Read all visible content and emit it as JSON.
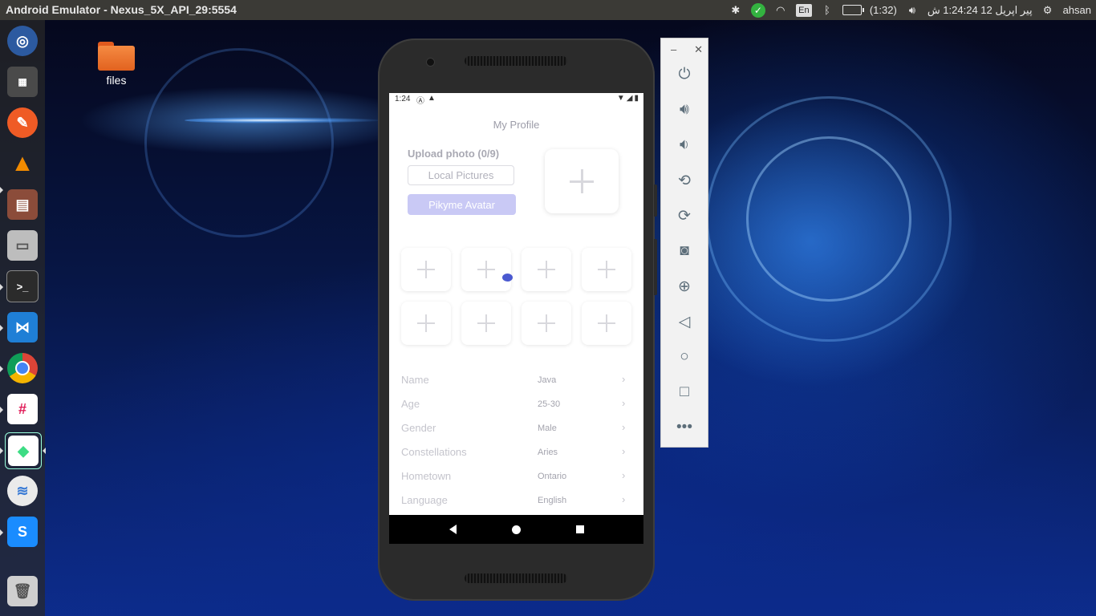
{
  "top_panel": {
    "title": "Android Emulator - Nexus_5X_API_29:5554",
    "keyboard_layout": "En",
    "battery": "(1:32)",
    "datetime": "پیر اپریل 12 1:24:24 ش",
    "user": "ahsan"
  },
  "desktop": {
    "folder_label": "files"
  },
  "launcher": {
    "items": [
      "ubuntu-dash",
      "workspaces",
      "postman",
      "vlc",
      "file-manager",
      "disk",
      "terminal",
      "vscode",
      "chrome",
      "slack",
      "android-studio",
      "database",
      "skype-preview",
      "trash"
    ]
  },
  "phone": {
    "status_time": "1:24",
    "screen_title": "My Profile",
    "upload_label": "Upload photo (0/9)",
    "local_pictures_button": "Local Pictures",
    "avatar_button": "Pikyme Avatar",
    "info_rows": [
      {
        "label": "Name",
        "value": "Java"
      },
      {
        "label": "Age",
        "value": "25-30"
      },
      {
        "label": "Gender",
        "value": "Male"
      },
      {
        "label": "Constellations",
        "value": "Aries"
      },
      {
        "label": "Hometown",
        "value": "Ontario"
      },
      {
        "label": "Language",
        "value": "English"
      }
    ]
  },
  "colors": {
    "accent_avatar_button": "#c9c9f5",
    "touch_indicator": "#4a59d0"
  }
}
